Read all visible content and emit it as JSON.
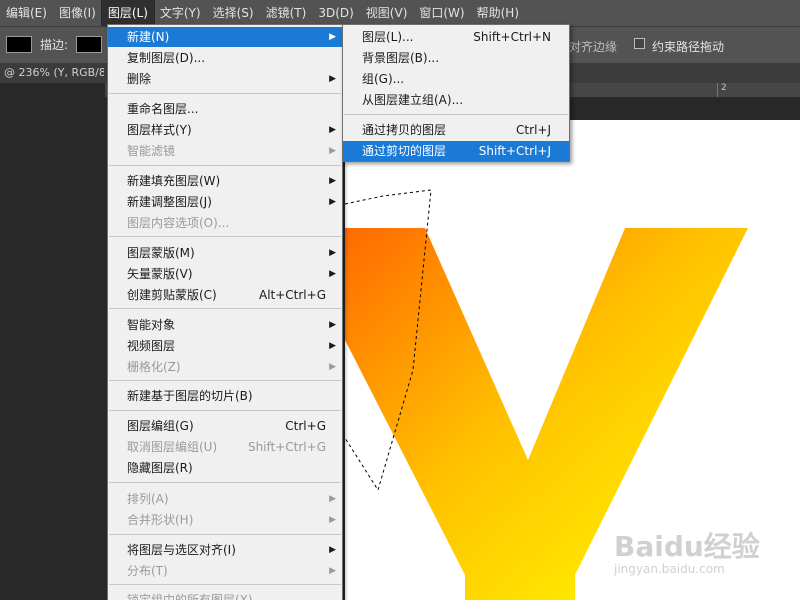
{
  "menubar": {
    "items": [
      "编辑(E)",
      "图像(I)",
      "图层(L)",
      "文字(Y)",
      "选择(S)",
      "滤镜(T)",
      "3D(D)",
      "视图(V)",
      "窗口(W)",
      "帮助(H)"
    ]
  },
  "options": {
    "stroke_label": "描边:",
    "align_edges": "对齐边缘",
    "constrain_path": "约束路径拖动"
  },
  "document": {
    "tab_title": "@ 236% (Y, RGB/8"
  },
  "ruler": {
    "label": "2"
  },
  "layer_menu": {
    "new": "新建(N)",
    "duplicate": "复制图层(D)...",
    "delete": "删除",
    "rename": "重命名图层...",
    "style": "图层样式(Y)",
    "smart_filter": "智能滤镜",
    "new_fill": "新建填充图层(W)",
    "new_adjust": "新建调整图层(J)",
    "content_options": "图层内容选项(O)...",
    "layer_mask": "图层蒙版(M)",
    "vector_mask": "矢量蒙版(V)",
    "clip_mask": "创建剪贴蒙版(C)",
    "clip_mask_shortcut": "Alt+Ctrl+G",
    "smart_object": "智能对象",
    "video_layers": "视频图层",
    "rasterize": "栅格化(Z)",
    "slice": "新建基于图层的切片(B)",
    "group": "图层编组(G)",
    "group_shortcut": "Ctrl+G",
    "ungroup": "取消图层编组(U)",
    "ungroup_shortcut": "Shift+Ctrl+G",
    "hide": "隐藏图层(R)",
    "arrange": "排列(A)",
    "combine_shapes": "合并形状(H)",
    "align_to_selection": "将图层与选区对齐(I)",
    "distribute": "分布(T)",
    "lock_all": "锁定组中的所有图层(X)..."
  },
  "new_submenu": {
    "layer": "图层(L)...",
    "layer_shortcut": "Shift+Ctrl+N",
    "background": "背景图层(B)...",
    "group": "组(G)...",
    "group_from_layers": "从图层建立组(A)...",
    "via_copy": "通过拷贝的图层",
    "via_copy_shortcut": "Ctrl+J",
    "via_cut": "通过剪切的图层",
    "via_cut_shortcut": "Shift+Ctrl+J"
  },
  "watermark": {
    "brand": "Baidu经验",
    "url": "jingyan.baidu.com"
  },
  "colors": {
    "menu_highlight": "#1a7ad6",
    "ps_panel": "#535353",
    "ps_dark": "#282828",
    "letter_orange": "#ff7a00",
    "letter_yellow": "#ffee00"
  }
}
